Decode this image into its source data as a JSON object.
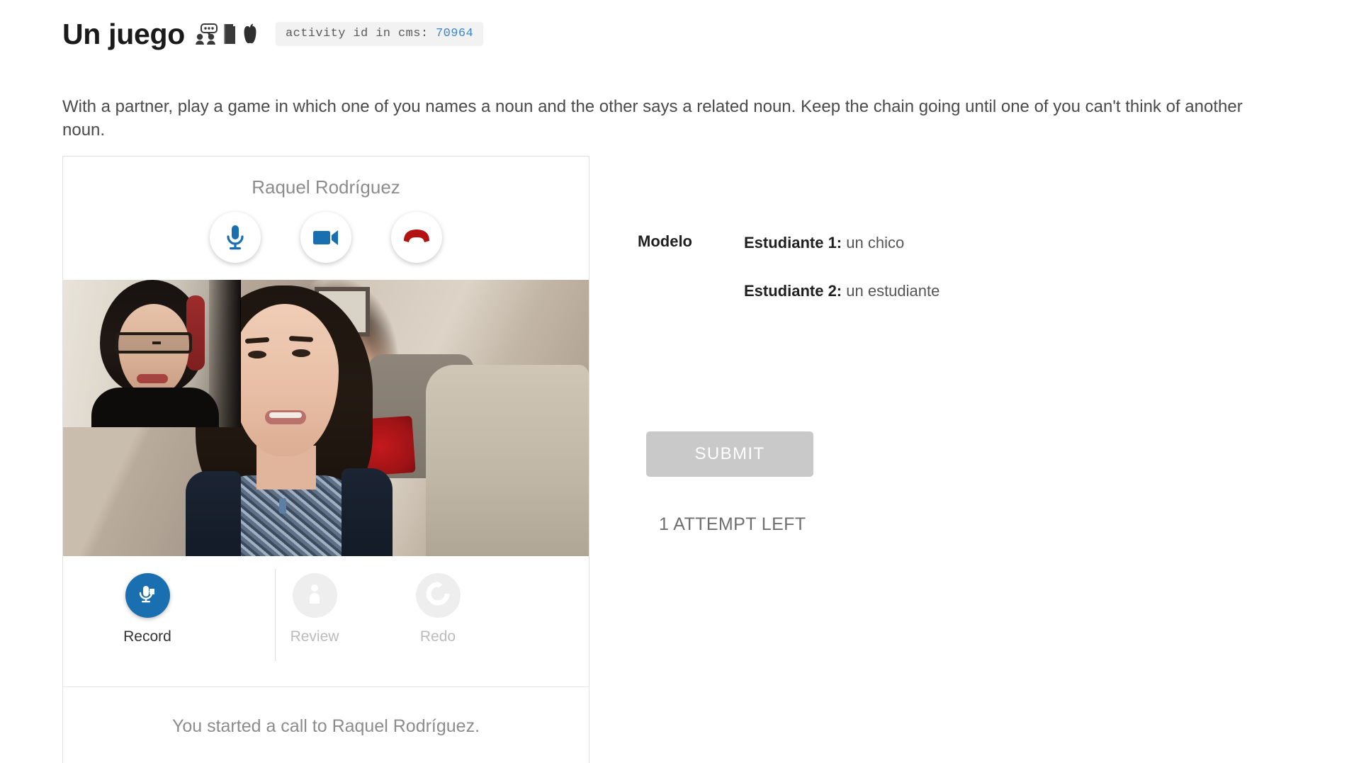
{
  "header": {
    "title": "Un juego",
    "icons": [
      "pair-conversation-icon",
      "book-icon",
      "apple-icon"
    ],
    "cms_badge_label": "activity id in cms:",
    "cms_badge_id": "70964",
    "cms_id_color": "#3a86c8"
  },
  "instructions": "With a partner, play a game in which one of you names a noun and the other says a related noun. Keep the chain going until one of you can't think of another noun.",
  "call_panel": {
    "callee_name": "Raquel Rodríguez",
    "controls": [
      {
        "name": "microphone",
        "icon": "microphone-icon",
        "color": "#1a6fb0"
      },
      {
        "name": "camera",
        "icon": "video-camera-icon",
        "color": "#1a6fb0"
      },
      {
        "name": "hang-up",
        "icon": "phone-hangup-icon",
        "color": "#b31212"
      }
    ],
    "status_message": "You started a call to Raquel Rodríguez."
  },
  "recorder": {
    "items": [
      {
        "label": "Record",
        "icon": "microphone-record-icon",
        "state": "active"
      },
      {
        "label": "Review",
        "icon": "person-play-icon",
        "state": "disabled"
      },
      {
        "label": "Redo",
        "icon": "refresh-circle-icon",
        "state": "disabled"
      }
    ],
    "active_color": "#1a6fb0",
    "disabled_color": "#eeeeee"
  },
  "model": {
    "label": "Modelo",
    "lines": [
      {
        "speaker": "Estudiante 1:",
        "text": " un chico"
      },
      {
        "speaker": "Estudiante 2:",
        "text": " un estudiante"
      }
    ]
  },
  "actions": {
    "submit_label": "SUBMIT",
    "submit_disabled": true,
    "attempts_text": "1 ATTEMPT LEFT"
  }
}
